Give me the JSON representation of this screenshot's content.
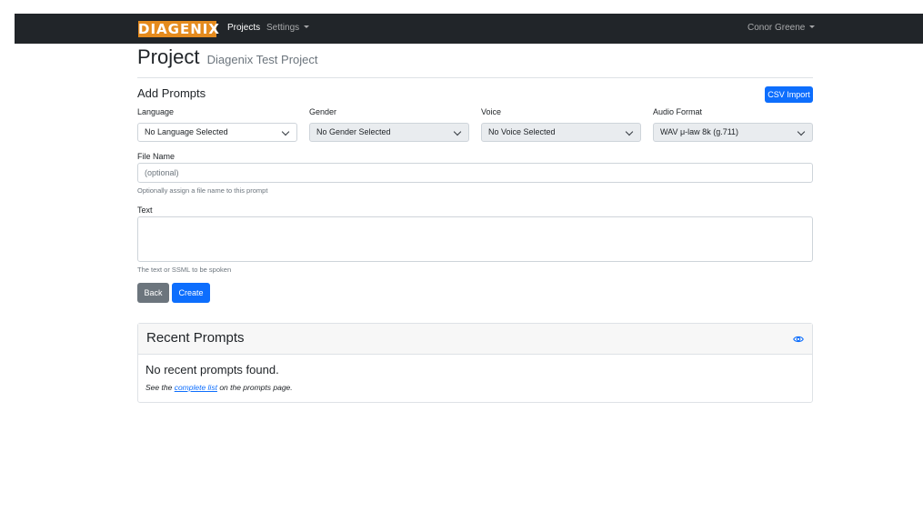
{
  "navbar": {
    "brand": "DIAGENIX",
    "projects": "Projects",
    "settings": "Settings",
    "user": "Conor Greene"
  },
  "header": {
    "title": "Project",
    "subtitle": "Diagenix Test Project"
  },
  "form": {
    "heading": "Add Prompts",
    "csv_import": "CSV Import",
    "language_label": "Language",
    "language_value": "No Language Selected",
    "gender_label": "Gender",
    "gender_value": "No Gender Selected",
    "voice_label": "Voice",
    "voice_value": "No Voice Selected",
    "audio_label": "Audio Format",
    "audio_value": "WAV μ-law 8k (g.711)",
    "filename_label": "File Name",
    "filename_placeholder": "(optional)",
    "filename_help": "Optionally assign a file name to this prompt",
    "text_label": "Text",
    "text_help": "The text or SSML to be spoken",
    "back": "Back",
    "create": "Create"
  },
  "recent": {
    "title": "Recent Prompts",
    "empty": "No recent prompts found.",
    "see_prefix": "See the",
    "see_link": "complete list",
    "see_suffix": "on the prompts page."
  },
  "colors": {
    "navbar": "#212529",
    "brand": "#e58b1e",
    "primary": "#0d6efd",
    "secondary": "#6c757d"
  }
}
